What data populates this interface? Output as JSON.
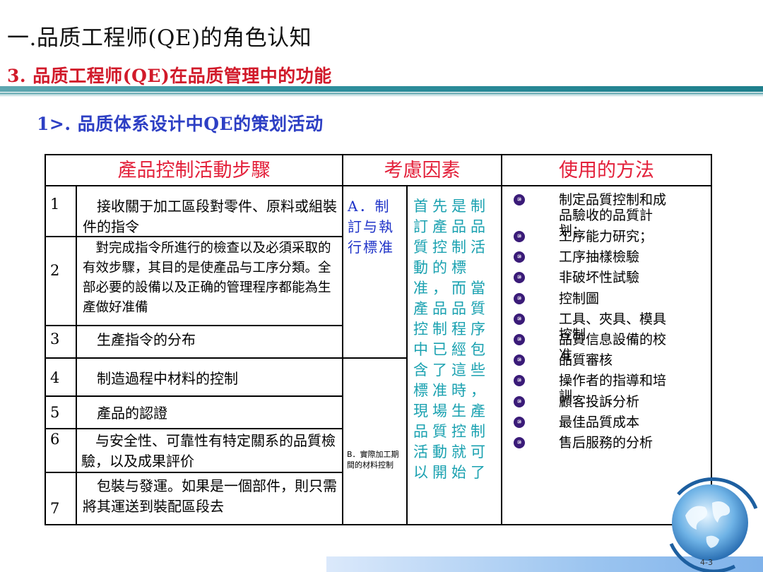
{
  "slide": {
    "title": "一.品质工程师(QE)的角色认知",
    "subtitle": "3. 品质工程师(QE)在品质管理中的功能",
    "section": "1>. 品质体系设计中QE的策划活动",
    "page_number": "4-3"
  },
  "table": {
    "headers": [
      "產品控制活動步驟",
      "考慮因素",
      "使用的方法"
    ],
    "steps": [
      {
        "num": "1",
        "text": "　接收關于加工區段對零件、原料或組裝件的指令"
      },
      {
        "num": "2",
        "text": "　對完成指令所進行的檢查以及必須采取的有效步驟，其目的是使產品与工序分類。全部必要的設備以及正确的管理程序都能為生產做好准備"
      },
      {
        "num": "3",
        "text": "　生產指令的分布"
      },
      {
        "num": "4",
        "text": "　制造過程中材料的控制"
      },
      {
        "num": "5",
        "text": "　產品的認證"
      },
      {
        "num": "6",
        "text": "　与安全性、可靠性有特定關系的品質檢驗，以及成果評价"
      },
      {
        "num": "7",
        "text": "　包裝与發運。如果是一個部件，則只需將其運送到裝配區段去"
      }
    ],
    "factor_a": "A．制訂与執行標准",
    "factor_b": "B．實際加工期間的材料控制",
    "factor_desc": "首先是制訂產品品質控制活動的標准，而當產品品質控制程序中已經包含了這些標准時，現場生產品質控制活動就可以開始了",
    "methods": [
      "制定品質控制和成品驗收的品質計划；",
      "工序能力研究；",
      "工序抽樣檢驗",
      "非破坏性試驗",
      "控制圖",
      "工具、夾具、模具控制",
      "品質信息設備的校准",
      "品質審核",
      "操作者的指導和培訓",
      "顧客投訴分析",
      "最佳品質成本",
      "售后服務的分析"
    ],
    "bullet_glyph": "⑩"
  }
}
